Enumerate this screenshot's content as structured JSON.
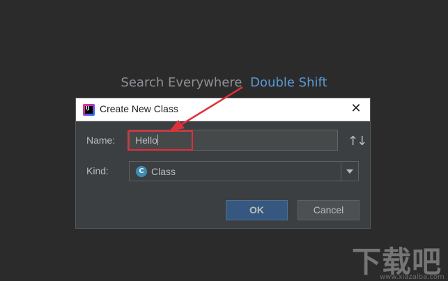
{
  "background_hint": {
    "text": "Search Everywhere",
    "shortcut": "Double Shift"
  },
  "dialog": {
    "title": "Create New Class",
    "name_label": "Name:",
    "name_value": "Hello",
    "kind_label": "Kind:",
    "kind_value": "Class",
    "class_icon_letter": "C",
    "ok_label": "OK",
    "cancel_label": "Cancel",
    "sort_icon": "↑↓",
    "close_icon": "✕",
    "app_icon_letters": "IJ"
  },
  "watermark": {
    "text": "下载吧",
    "url": "www.xiazaiba.com"
  },
  "colors": {
    "accent": "#5a9bd5",
    "annotation": "#e0303a",
    "ok_button": "#365880",
    "dialog_bg": "#3c3f41",
    "page_bg": "#2b2b2c"
  }
}
